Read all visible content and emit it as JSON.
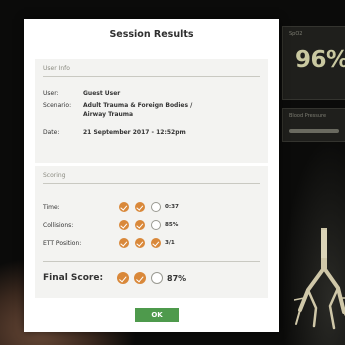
{
  "monitor": {
    "spo2_label": "SpO2",
    "spo2_value": "96%",
    "secondary_label": "Blood Pressure"
  },
  "dialog": {
    "title": "Session Results",
    "user_info": {
      "heading": "User Info",
      "user_label": "User:",
      "user_value": "Guest User",
      "scenario_label": "Scenario:",
      "scenario_value": "Adult Trauma & Foreign Bodies / Airway Trauma",
      "date_label": "Date:",
      "date_value": "21 September 2017 - 12:52pm"
    },
    "scoring": {
      "heading": "Scoring",
      "time_label": "Time:",
      "time_value": "0:37",
      "time_checks": [
        true,
        true,
        false
      ],
      "collisions_label": "Collisions:",
      "collisions_value": "85%",
      "collisions_checks": [
        true,
        true,
        false
      ],
      "ett_label": "ETT Position:",
      "ett_value": "3/1",
      "ett_checks": [
        true,
        true,
        true
      ],
      "final_label": "Final Score:",
      "final_value": "87%",
      "final_checks": [
        true,
        true,
        false
      ]
    },
    "ok_label": "OK"
  },
  "colors": {
    "check_on": "#d9883a",
    "ok_button": "#4e9a4c",
    "monitor_value": "#c9c8a0"
  }
}
